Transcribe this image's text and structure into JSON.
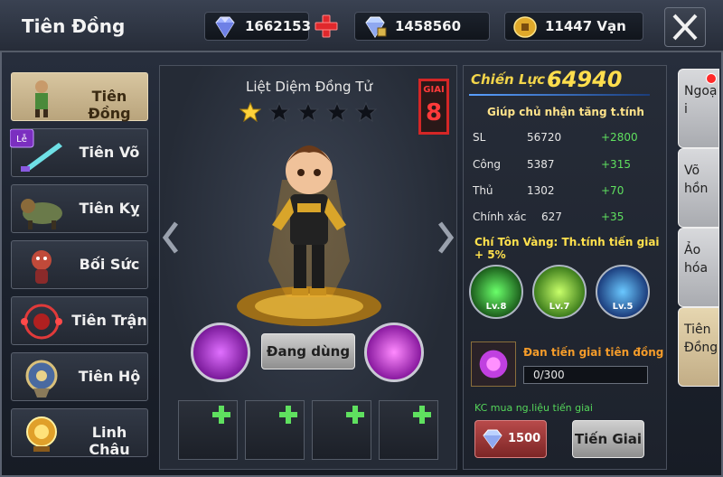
{
  "header": {
    "title": "Tiên Đồng",
    "currencies": [
      {
        "name": "diamond",
        "value": "1662153"
      },
      {
        "name": "bound-diamond",
        "value": "1458560"
      },
      {
        "name": "coin",
        "value": "11447 Vạn"
      }
    ]
  },
  "menu": [
    {
      "label": "Tiên Đồng",
      "active": true
    },
    {
      "label": "Tiên Võ",
      "badge": "Lễ"
    },
    {
      "label": "Tiên Kỵ"
    },
    {
      "label": "Bối Sức"
    },
    {
      "label": "Tiên Trận"
    },
    {
      "label": "Tiên Hộ"
    },
    {
      "label": "Linh Châu"
    }
  ],
  "hero": {
    "name": "Liệt Diệm Đồng Tử",
    "stars_filled": 1,
    "stars_total": 5,
    "grade_label": "GIAI",
    "grade_value": "8",
    "use_label": "Đang dùng"
  },
  "info": {
    "combat_label": "Chiến Lực :",
    "combat_value": "64940",
    "hint": "Giúp chủ nhận tăng t.tính",
    "stats": [
      {
        "name": "SL",
        "value": "56720",
        "bonus": "+2800"
      },
      {
        "name": "Công",
        "value": "5387",
        "bonus": "+315"
      },
      {
        "name": "Thủ",
        "value": "1302",
        "bonus": "+70"
      },
      {
        "name": "Chính xác",
        "value": "627",
        "bonus": "+35"
      }
    ],
    "bonus_text": "Chí Tôn Vàng: Th.tính tiến giai + 5%",
    "skills": [
      {
        "level": "Lv.8",
        "color": "#3aa83a"
      },
      {
        "level": "Lv.7",
        "color": "#7fd03a"
      },
      {
        "level": "Lv.5",
        "color": "#3a88e0"
      }
    ],
    "material_name": "Đan tiến giai tiên đồng",
    "material_progress": "0/300",
    "material_fraction": 0,
    "kc_label": "KC mua ng.liệu tiến giai",
    "price": "1500",
    "upgrade_label": "Tiến Giai"
  },
  "tabs": [
    {
      "label": "Ngoạ i",
      "dot": true
    },
    {
      "label": "Võ hồn"
    },
    {
      "label": "Ảo hóa"
    },
    {
      "label": "Tiên Đồng",
      "active": true
    }
  ]
}
